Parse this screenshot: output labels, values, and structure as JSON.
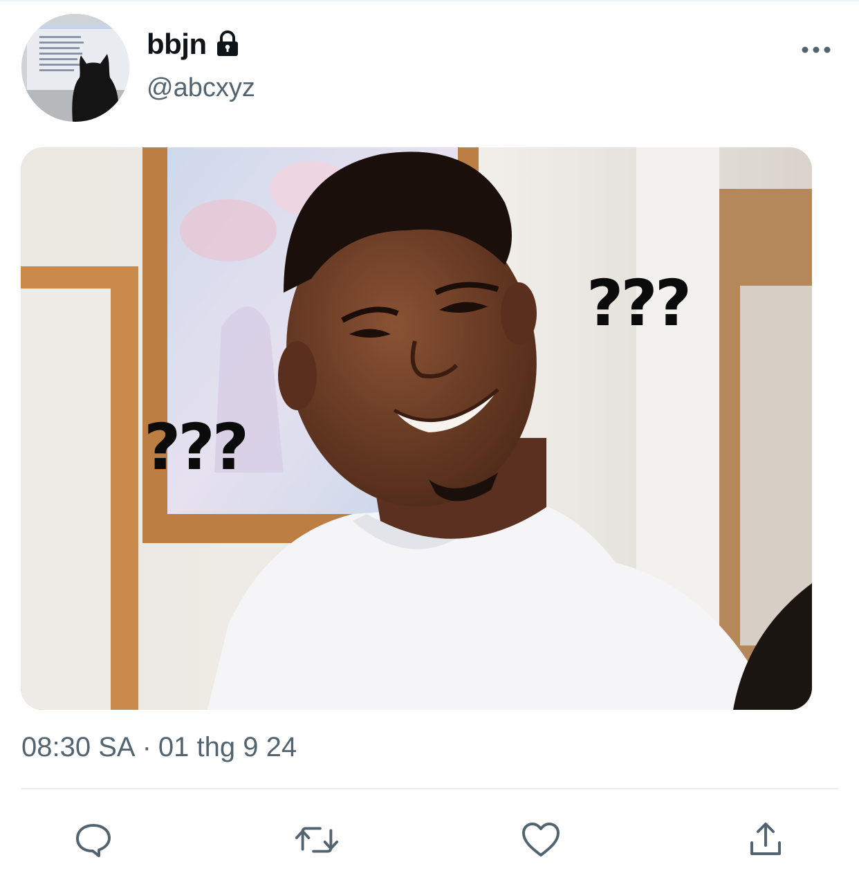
{
  "tweet": {
    "author": {
      "display_name": "bbjn",
      "handle": "@abcxyz",
      "protected_icon": "lock-icon"
    },
    "media": {
      "overlay_text_right": "???",
      "overlay_text_left": "???"
    },
    "timestamp": {
      "time": "08:30 SA",
      "separator": "·",
      "date": "01 thg 9 24"
    }
  },
  "actions": [
    {
      "name": "reply",
      "icon": "comment-icon"
    },
    {
      "name": "retweet",
      "icon": "retweet-icon"
    },
    {
      "name": "like",
      "icon": "heart-icon"
    },
    {
      "name": "share",
      "icon": "share-icon"
    }
  ],
  "colors": {
    "text_primary": "#0f1419",
    "text_secondary": "#536471",
    "divider": "#e8ecef"
  }
}
